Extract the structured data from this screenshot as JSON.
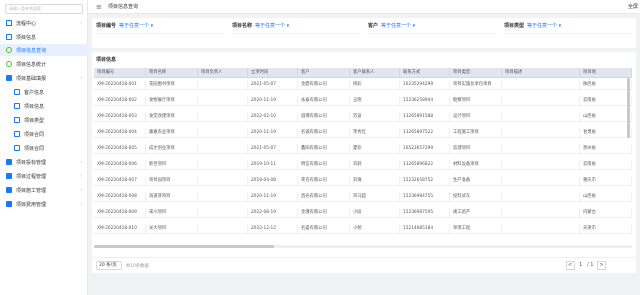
{
  "sidebar": {
    "search_placeholder": "请输入菜单名搜索",
    "items": [
      {
        "label": "流程中心",
        "icon": "home-icon",
        "type": "group"
      },
      {
        "label": "项目信息",
        "icon": "file-icon",
        "type": "item"
      },
      {
        "label": "项目信息查询",
        "icon": "circle-icon",
        "type": "item",
        "active": true
      },
      {
        "label": "项目信息统计",
        "icon": "circle-icon",
        "type": "item"
      },
      {
        "label": "项目基础填报",
        "icon": "folder-icon",
        "type": "group"
      },
      {
        "label": "客户信息",
        "icon": "file-icon",
        "type": "sub"
      },
      {
        "label": "项目信息",
        "icon": "file-icon",
        "type": "sub"
      },
      {
        "label": "项目类型",
        "icon": "file-icon",
        "type": "sub"
      },
      {
        "label": "项目合同",
        "icon": "file-icon",
        "type": "sub"
      },
      {
        "label": "项目合同",
        "icon": "file-icon",
        "type": "sub"
      },
      {
        "label": "项目投标管理",
        "icon": "folder-icon",
        "type": "group"
      },
      {
        "label": "项目过程管理",
        "icon": "folder-icon",
        "type": "group"
      },
      {
        "label": "项目施工管理",
        "icon": "folder-icon",
        "type": "group"
      },
      {
        "label": "项目费用管理",
        "icon": "folder-icon",
        "type": "group"
      }
    ]
  },
  "topbar": {
    "menu_icon": "≡",
    "title": "项目信息查询",
    "right": "全屏"
  },
  "filters": [
    {
      "label": "项目编号",
      "value": "等于任意一个"
    },
    {
      "label": "项目名称",
      "value": "等于任意一个"
    },
    {
      "label": "客户",
      "value": "等于任意一个"
    },
    {
      "label": "项目类型",
      "value": "等于任意一个"
    }
  ],
  "table": {
    "title": "项目信息",
    "columns": [
      "项目编号",
      "项目名称",
      "项目负责人",
      "立项时间",
      "客户",
      "客户联系人",
      "联系方式",
      "项目类型",
      "项目描述",
      "项目地"
    ],
    "rows": [
      [
        "XM-20220428-001",
        "花园图书项目",
        "",
        "2021-05-07",
        "金鼎有限公司",
        "杨彩",
        "16235294299",
        "项目实施总承包项目",
        "",
        "陕西省"
      ],
      [
        "XM-20220428-002",
        "食物展厅项目",
        "",
        "2020-11-19",
        "永泰有限公司",
        "王晓",
        "15236258944",
        "勘察项目",
        "",
        "云南省"
      ],
      [
        "XM-20220428-003",
        "食堂改建项目",
        "",
        "2022-02-10",
        "诚博有限公司",
        "苏波",
        "13265891588",
        "设计项目",
        "",
        "山西省"
      ],
      [
        "XM-20220428-004",
        "康嘉农业项目",
        "",
        "2020-11-19",
        "名诚有限公司",
        "李秀红",
        "13265897522",
        "工程施工项目",
        "",
        "甘肃省"
      ],
      [
        "XM-20220428-005",
        "成才创业项目",
        "",
        "2021-05-07",
        "鑫阳有限公司",
        "夏欢",
        "16523657299",
        "监理项目",
        "",
        "贵州省"
      ],
      [
        "XM-20220428-006",
        "新世项目",
        "",
        "2019-10-11",
        "明信有限公司",
        "刘莉",
        "13265896822",
        "材料设备项目",
        "",
        "云南省"
      ],
      [
        "XM-20220428-007",
        "项目园项目",
        "",
        "2018-04-08",
        "荣百有限公司",
        "刘锋",
        "15232658752",
        "生产准备",
        "",
        "重庆市"
      ],
      [
        "XM-20220428-008",
        "海道芽项目",
        "",
        "2020-11-19",
        "昌光有限公司",
        "邓马超",
        "15236984755",
        "投料试车",
        "",
        "山西省"
      ],
      [
        "XM-20220428-009",
        "宋川项目",
        "",
        "2022-08-19",
        "金瑾有限公司",
        "小段",
        "15236987595",
        "竣工验产",
        "",
        "内蒙古"
      ],
      [
        "XM-20220428-010",
        "光大项目",
        "",
        "2022-12-12",
        "名盛有限公司",
        "小杨",
        "15214685184",
        "单项工程",
        "",
        "天津市"
      ]
    ]
  },
  "pager": {
    "page_size": "20 条/页",
    "no_data": "共10条数据",
    "prev": "<",
    "current": "1",
    "total": "/ 1",
    "next": ">"
  }
}
